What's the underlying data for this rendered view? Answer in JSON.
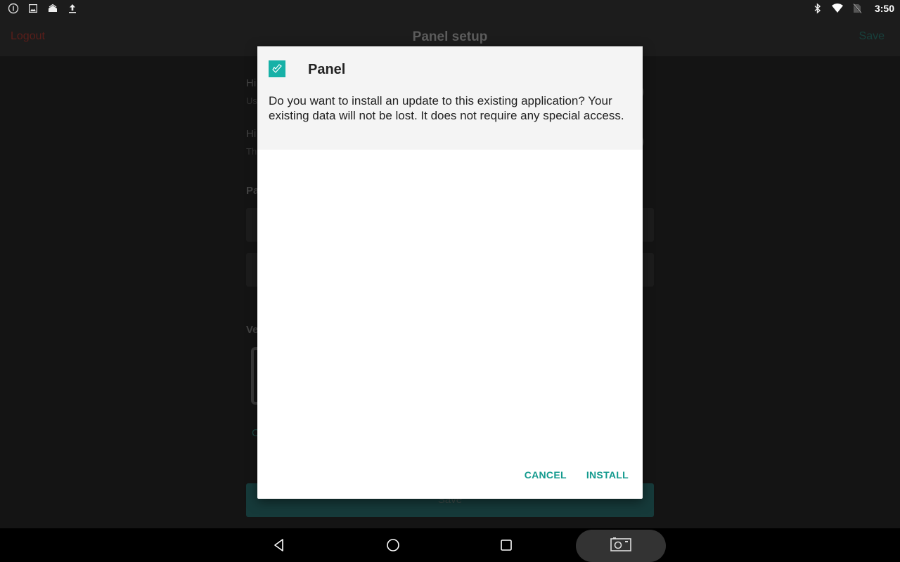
{
  "status_bar": {
    "left_icons": [
      "info-icon",
      "image-icon",
      "home-upload-icon",
      "upload-icon"
    ],
    "right_icons": [
      "bluetooth-icon",
      "wifi-icon",
      "no-sim-icon"
    ],
    "time": "3:50"
  },
  "app_bar": {
    "logout_label": "Logout",
    "title": "Panel setup",
    "save_label": "Save"
  },
  "background": {
    "fragments": [
      "Hi",
      "Us",
      "Hi",
      "Th",
      "Pa",
      "Ve",
      "C"
    ],
    "save_button_label": "Save"
  },
  "dialog": {
    "app_icon": "panel-app-icon",
    "title": "Panel",
    "message": "Do you want to install an update to this existing application? Your existing data will not be lost. It does not require any special access.",
    "cancel_label": "CANCEL",
    "install_label": "INSTALL"
  },
  "nav_bar": {
    "back": "back-icon",
    "home": "home-icon",
    "recents": "recents-icon",
    "screenshot": "camera-icon"
  },
  "colors": {
    "accent": "#139a8e",
    "app_icon_bg": "#17b1a7",
    "logout": "#5a1e1a"
  }
}
